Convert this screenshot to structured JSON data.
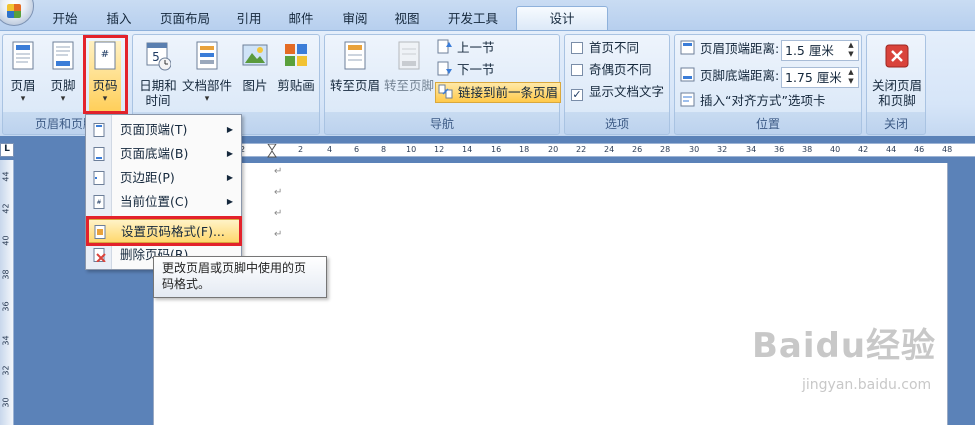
{
  "tabs": [
    "开始",
    "插入",
    "页面布局",
    "引用",
    "邮件",
    "审阅",
    "视图",
    "开发工具",
    "设计"
  ],
  "ribbon": {
    "header_footer_group": {
      "label": "页眉和页脚",
      "header_btn": "页眉",
      "footer_btn": "页脚",
      "pagenum_btn": "页码"
    },
    "insert_group": {
      "datetime_line1": "日期和",
      "datetime_line2": "时间",
      "parts_btn": "文档部件",
      "picture_btn": "图片",
      "clipart_btn": "剪贴画"
    },
    "nav_group": {
      "label": "导航",
      "goto_header": "转至页眉",
      "goto_footer": "转至页脚",
      "prev": "上一节",
      "next": "下一节",
      "link_prev": "链接到前一条页眉"
    },
    "options_group": {
      "label": "选项",
      "diff_first": "首页不同",
      "diff_odd_even": "奇偶页不同",
      "show_text": "显示文档文字"
    },
    "position_group": {
      "label": "位置",
      "header_dist_label": "页眉顶端距离:",
      "header_dist_value": "1.5 厘米",
      "footer_dist_label": "页脚底端距离:",
      "footer_dist_value": "1.75 厘米",
      "insert_align_tab": "插入“对齐方式”选项卡"
    },
    "close_group": {
      "label": "关闭",
      "close_line1": "关闭页眉",
      "close_line2": "和页脚"
    }
  },
  "ruler_corner": "L",
  "hruler_ticks": [
    "2",
    "2",
    "4",
    "6",
    "8",
    "10",
    "12",
    "14",
    "16",
    "18",
    "20",
    "22",
    "24",
    "26",
    "28",
    "30",
    "32",
    "34",
    "36",
    "38",
    "40",
    "42",
    "44",
    "46",
    "48"
  ],
  "vruler_ticks": [
    "44",
    "42",
    "40",
    "38",
    "36",
    "34",
    "32",
    "30"
  ],
  "para_marks": [
    "↵",
    "↵",
    "↵",
    "↵"
  ],
  "dropdown": {
    "items": [
      {
        "label": "页面顶端(T)",
        "has_sub": true
      },
      {
        "label": "页面底端(B)",
        "has_sub": true
      },
      {
        "label": "页边距(P)",
        "has_sub": true
      },
      {
        "label": "当前位置(C)",
        "has_sub": true
      },
      {
        "label": "设置页码格式(F)...",
        "has_sub": false
      },
      {
        "label": "删除页码(R)",
        "has_sub": false
      }
    ],
    "sub_arrow": "▶"
  },
  "tooltip": {
    "line1": "更改页眉或页脚中使用的页",
    "line2": "码格式。"
  },
  "watermark": {
    "logo": "Baidu经验",
    "url": "jingyan.baidu.com"
  },
  "colors": {
    "accent_red": "#e3222b",
    "menu_hover": "#ffd86e",
    "ribbon_bg": "#d6e5f8"
  }
}
